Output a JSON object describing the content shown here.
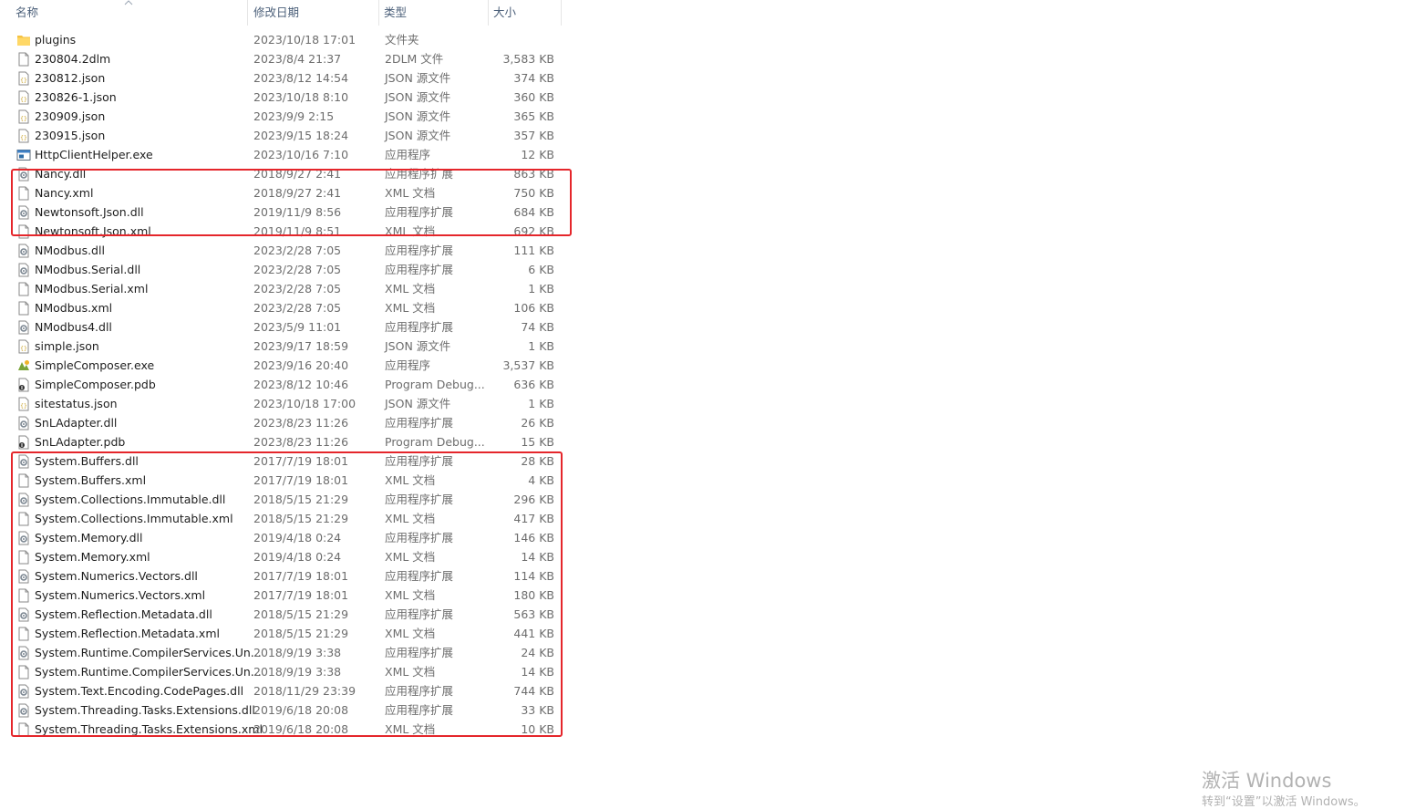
{
  "columns": {
    "name": "名称",
    "date": "修改日期",
    "type": "类型",
    "size": "大小"
  },
  "files": [
    {
      "name": "plugins",
      "date": "2023/10/18 17:01",
      "type": "文件夹",
      "size": "",
      "icon": "folder-icon"
    },
    {
      "name": "230804.2dlm",
      "date": "2023/8/4 21:37",
      "type": "2DLM 文件",
      "size": "3,583 KB",
      "icon": "file-icon"
    },
    {
      "name": "230812.json",
      "date": "2023/8/12 14:54",
      "type": "JSON 源文件",
      "size": "374 KB",
      "icon": "json-file-icon"
    },
    {
      "name": "230826-1.json",
      "date": "2023/10/18 8:10",
      "type": "JSON 源文件",
      "size": "360 KB",
      "icon": "json-file-icon"
    },
    {
      "name": "230909.json",
      "date": "2023/9/9 2:15",
      "type": "JSON 源文件",
      "size": "365 KB",
      "icon": "json-file-icon"
    },
    {
      "name": "230915.json",
      "date": "2023/9/15 18:24",
      "type": "JSON 源文件",
      "size": "357 KB",
      "icon": "json-file-icon"
    },
    {
      "name": "HttpClientHelper.exe",
      "date": "2023/10/16 7:10",
      "type": "应用程序",
      "size": "12 KB",
      "icon": "exe-window-icon"
    },
    {
      "name": "Nancy.dll",
      "date": "2018/9/27 2:41",
      "type": "应用程序扩展",
      "size": "863 KB",
      "icon": "dll-gear-icon"
    },
    {
      "name": "Nancy.xml",
      "date": "2018/9/27 2:41",
      "type": "XML 文档",
      "size": "750 KB",
      "icon": "file-icon"
    },
    {
      "name": "Newtonsoft.Json.dll",
      "date": "2019/11/9 8:56",
      "type": "应用程序扩展",
      "size": "684 KB",
      "icon": "dll-gear-icon"
    },
    {
      "name": "Newtonsoft.Json.xml",
      "date": "2019/11/9 8:51",
      "type": "XML 文档",
      "size": "692 KB",
      "icon": "file-icon"
    },
    {
      "name": "NModbus.dll",
      "date": "2023/2/28 7:05",
      "type": "应用程序扩展",
      "size": "111 KB",
      "icon": "dll-gear-icon"
    },
    {
      "name": "NModbus.Serial.dll",
      "date": "2023/2/28 7:05",
      "type": "应用程序扩展",
      "size": "6 KB",
      "icon": "dll-gear-icon"
    },
    {
      "name": "NModbus.Serial.xml",
      "date": "2023/2/28 7:05",
      "type": "XML 文档",
      "size": "1 KB",
      "icon": "file-icon"
    },
    {
      "name": "NModbus.xml",
      "date": "2023/2/28 7:05",
      "type": "XML 文档",
      "size": "106 KB",
      "icon": "file-icon"
    },
    {
      "name": "NModbus4.dll",
      "date": "2023/5/9 11:01",
      "type": "应用程序扩展",
      "size": "74 KB",
      "icon": "dll-gear-icon"
    },
    {
      "name": "simple.json",
      "date": "2023/9/17 18:59",
      "type": "JSON 源文件",
      "size": "1 KB",
      "icon": "json-file-icon"
    },
    {
      "name": "SimpleComposer.exe",
      "date": "2023/9/16 20:40",
      "type": "应用程序",
      "size": "3,537 KB",
      "icon": "app-custom-icon"
    },
    {
      "name": "SimpleComposer.pdb",
      "date": "2023/8/12 10:46",
      "type": "Program Debug...",
      "size": "636 KB",
      "icon": "pdb-file-icon"
    },
    {
      "name": "sitestatus.json",
      "date": "2023/10/18 17:00",
      "type": "JSON 源文件",
      "size": "1 KB",
      "icon": "json-file-icon"
    },
    {
      "name": "SnLAdapter.dll",
      "date": "2023/8/23 11:26",
      "type": "应用程序扩展",
      "size": "26 KB",
      "icon": "dll-gear-icon"
    },
    {
      "name": "SnLAdapter.pdb",
      "date": "2023/8/23 11:26",
      "type": "Program Debug...",
      "size": "15 KB",
      "icon": "pdb-file-icon"
    },
    {
      "name": "System.Buffers.dll",
      "date": "2017/7/19 18:01",
      "type": "应用程序扩展",
      "size": "28 KB",
      "icon": "dll-gear-icon"
    },
    {
      "name": "System.Buffers.xml",
      "date": "2017/7/19 18:01",
      "type": "XML 文档",
      "size": "4 KB",
      "icon": "file-icon"
    },
    {
      "name": "System.Collections.Immutable.dll",
      "date": "2018/5/15 21:29",
      "type": "应用程序扩展",
      "size": "296 KB",
      "icon": "dll-gear-icon"
    },
    {
      "name": "System.Collections.Immutable.xml",
      "date": "2018/5/15 21:29",
      "type": "XML 文档",
      "size": "417 KB",
      "icon": "file-icon"
    },
    {
      "name": "System.Memory.dll",
      "date": "2019/4/18 0:24",
      "type": "应用程序扩展",
      "size": "146 KB",
      "icon": "dll-gear-icon"
    },
    {
      "name": "System.Memory.xml",
      "date": "2019/4/18 0:24",
      "type": "XML 文档",
      "size": "14 KB",
      "icon": "file-icon"
    },
    {
      "name": "System.Numerics.Vectors.dll",
      "date": "2017/7/19 18:01",
      "type": "应用程序扩展",
      "size": "114 KB",
      "icon": "dll-gear-icon"
    },
    {
      "name": "System.Numerics.Vectors.xml",
      "date": "2017/7/19 18:01",
      "type": "XML 文档",
      "size": "180 KB",
      "icon": "file-icon"
    },
    {
      "name": "System.Reflection.Metadata.dll",
      "date": "2018/5/15 21:29",
      "type": "应用程序扩展",
      "size": "563 KB",
      "icon": "dll-gear-icon"
    },
    {
      "name": "System.Reflection.Metadata.xml",
      "date": "2018/5/15 21:29",
      "type": "XML 文档",
      "size": "441 KB",
      "icon": "file-icon"
    },
    {
      "name": "System.Runtime.CompilerServices.Un...",
      "date": "2018/9/19 3:38",
      "type": "应用程序扩展",
      "size": "24 KB",
      "icon": "dll-gear-icon"
    },
    {
      "name": "System.Runtime.CompilerServices.Un...",
      "date": "2018/9/19 3:38",
      "type": "XML 文档",
      "size": "14 KB",
      "icon": "file-icon"
    },
    {
      "name": "System.Text.Encoding.CodePages.dll",
      "date": "2018/11/29 23:39",
      "type": "应用程序扩展",
      "size": "744 KB",
      "icon": "dll-gear-icon"
    },
    {
      "name": "System.Threading.Tasks.Extensions.dll",
      "date": "2019/6/18 20:08",
      "type": "应用程序扩展",
      "size": "33 KB",
      "icon": "dll-gear-icon"
    },
    {
      "name": "System.Threading.Tasks.Extensions.xml",
      "date": "2019/6/18 20:08",
      "type": "XML 文档",
      "size": "10 KB",
      "icon": "file-icon"
    }
  ],
  "watermark": {
    "line1": "激活 Windows",
    "line2": "转到“设置”以激活 Windows。"
  },
  "colors": {
    "highlight": "#e5262b",
    "folder": "#f5c242",
    "header_text": "#4c607a",
    "secondary_text": "#6d6d6d"
  }
}
